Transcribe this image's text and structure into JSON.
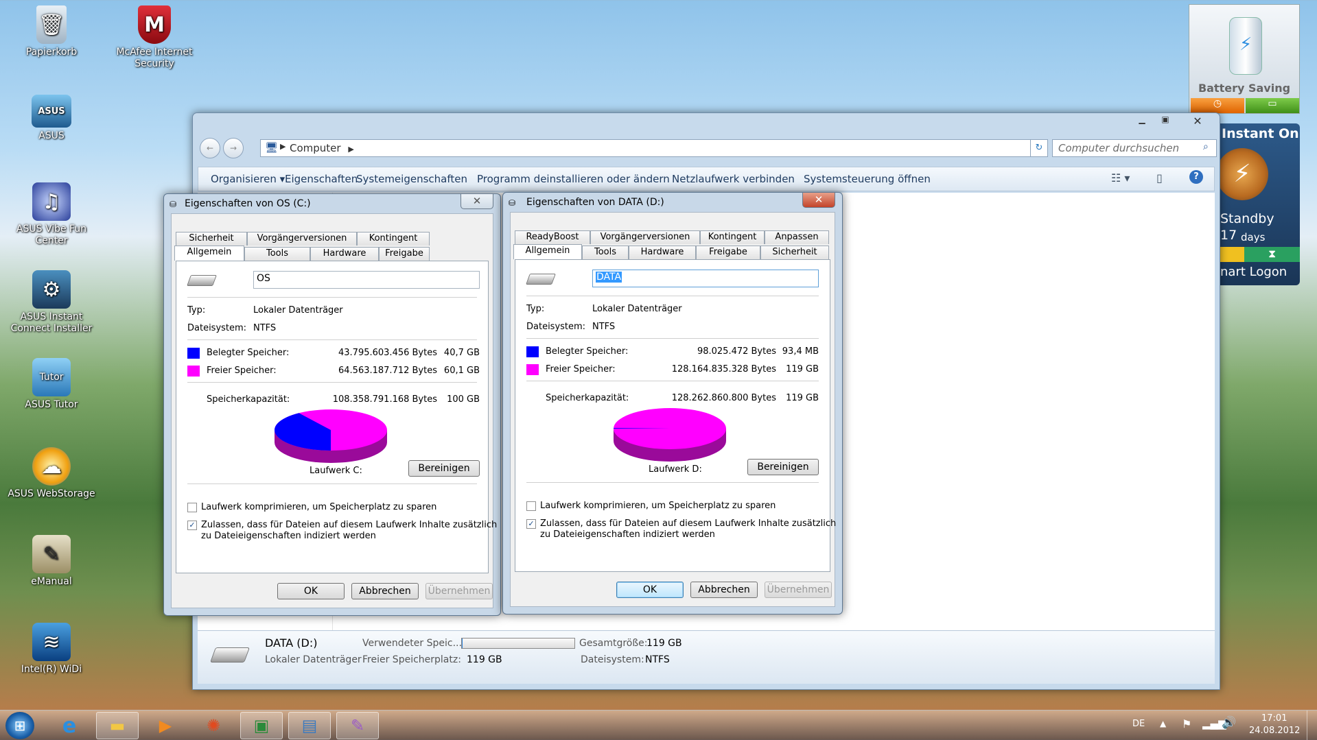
{
  "desktop": {
    "icons": [
      {
        "label": "Papierkorb",
        "icon": "recycle-bin-icon"
      },
      {
        "label": "McAfee Internet Security",
        "icon": "mcafee-icon"
      },
      {
        "label": "ASUS",
        "icon": "asus-icon"
      },
      {
        "label": "ASUS  Vibe Fun Center",
        "icon": "vibe-icon"
      },
      {
        "label": "ASUS Instant Connect Installer",
        "icon": "instant-connect-icon"
      },
      {
        "label": "ASUS Tutor",
        "icon": "tutor-icon"
      },
      {
        "label": "ASUS WebStorage",
        "icon": "webstorage-icon"
      },
      {
        "label": "eManual",
        "icon": "emanual-icon"
      },
      {
        "label": "Intel(R) WiDi",
        "icon": "widi-icon"
      }
    ]
  },
  "gadgets": {
    "battery": {
      "label": "Battery Saving"
    },
    "instant_on": {
      "title": "Instant On",
      "standby": "Standby",
      "days_num": "17",
      "days_label": "days",
      "logon": "nart Logon"
    }
  },
  "explorer": {
    "address": "Computer",
    "search_placeholder": "Computer durchsuchen",
    "commands": [
      "Organisieren ▾",
      "Eigenschaften",
      "Systemeigenschaften",
      "Programm deinstallieren oder ändern",
      "Netzlaufwerk verbinden",
      "Systemsteuerung öffnen"
    ],
    "details": {
      "name": "DATA (D:)",
      "type": "Lokaler Datenträger",
      "used_label": "Verwendeter Speic...",
      "free_label": "Freier Speicherplatz:",
      "free_value": "119 GB",
      "total_label": "Gesamtgröße:",
      "total_value": "119 GB",
      "fs_label": "Dateisystem:",
      "fs_value": "NTFS",
      "used_fraction": 0.001
    }
  },
  "dialog_c": {
    "title": "Eigenschaften von OS (C:)",
    "tabs_back": [
      "Sicherheit",
      "Vorgängerversionen",
      "Kontingent"
    ],
    "tabs_front": [
      "Allgemein",
      "Tools",
      "Hardware",
      "Freigabe"
    ],
    "name": "OS",
    "type_label": "Typ:",
    "type_value": "Lokaler Datenträger",
    "fs_label": "Dateisystem:",
    "fs_value": "NTFS",
    "used_label": "Belegter Speicher:",
    "used_bytes": "43.795.603.456 Bytes",
    "used_gb": "40,7 GB",
    "free_label": "Freier Speicher:",
    "free_bytes": "64.563.187.712 Bytes",
    "free_gb": "60,1 GB",
    "cap_label": "Speicherkapazität:",
    "cap_bytes": "108.358.791.168 Bytes",
    "cap_gb": "100 GB",
    "drive_label": "Laufwerk C:",
    "cleanup": "Bereinigen",
    "compress": "Laufwerk komprimieren, um Speicherplatz zu sparen",
    "index_line1": "Zulassen, dass für Dateien auf diesem Laufwerk Inhalte zusätzlich",
    "index_line2": "zu Dateieigenschaften indiziert werden",
    "ok": "OK",
    "cancel": "Abbrechen",
    "apply": "Übernehmen",
    "used_fraction": 0.404
  },
  "dialog_d": {
    "title": "Eigenschaften von DATA (D:)",
    "tabs_back": [
      "ReadyBoost",
      "Vorgängerversionen",
      "Kontingent",
      "Anpassen"
    ],
    "tabs_front": [
      "Allgemein",
      "Tools",
      "Hardware",
      "Freigabe",
      "Sicherheit"
    ],
    "name": "DATA",
    "type_label": "Typ:",
    "type_value": "Lokaler Datenträger",
    "fs_label": "Dateisystem:",
    "fs_value": "NTFS",
    "used_label": "Belegter Speicher:",
    "used_bytes": "98.025.472 Bytes",
    "used_gb": "93,4 MB",
    "free_label": "Freier Speicher:",
    "free_bytes": "128.164.835.328 Bytes",
    "free_gb": "119 GB",
    "cap_label": "Speicherkapazität:",
    "cap_bytes": "128.262.860.800 Bytes",
    "cap_gb": "119 GB",
    "drive_label": "Laufwerk D:",
    "cleanup": "Bereinigen",
    "compress": "Laufwerk komprimieren, um Speicherplatz zu sparen",
    "index_line1": "Zulassen, dass für Dateien auf diesem Laufwerk Inhalte zusätzlich",
    "index_line2": "zu Dateieigenschaften indiziert werden",
    "ok": "OK",
    "cancel": "Abbrechen",
    "apply": "Übernehmen",
    "used_fraction": 0.001
  },
  "colors": {
    "used": "#0000ff",
    "free": "#ff00ff"
  },
  "taskbar": {
    "lang": "DE",
    "time": "17:01",
    "date": "24.08.2012",
    "apps": [
      "start-orb-icon",
      "internet-explorer-icon",
      "explorer-folder-icon",
      "media-player-icon",
      "paint-icon",
      "monitor-icon",
      "control-panel-icon",
      "brush-icon"
    ]
  }
}
